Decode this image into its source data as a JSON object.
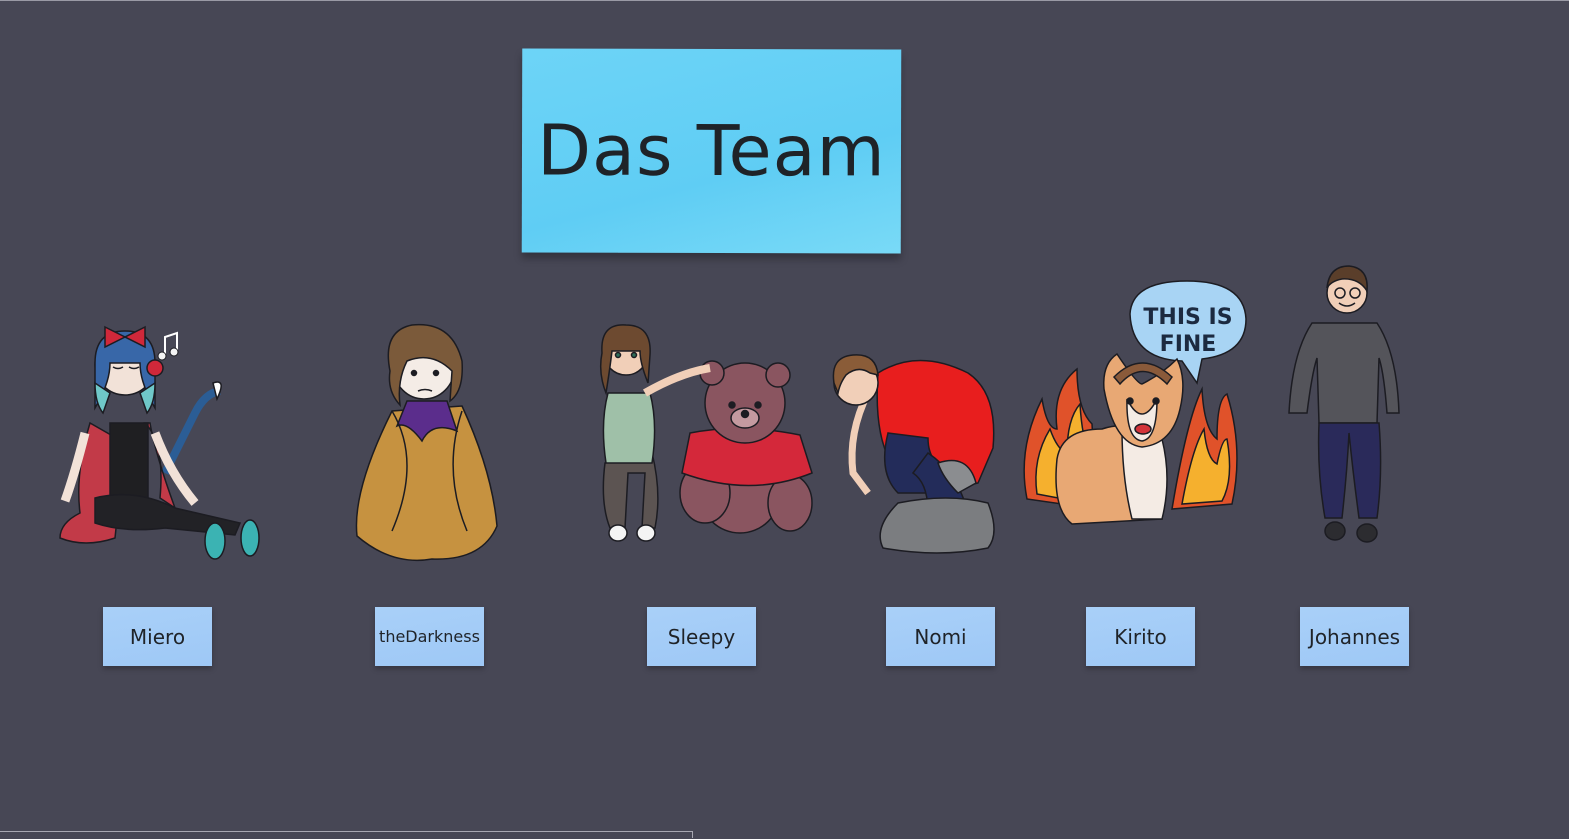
{
  "board": {
    "title": "Das Team",
    "bubble_text_line1": "THIS IS",
    "bubble_text_line2": "FINE"
  },
  "members": [
    {
      "name": "Miero"
    },
    {
      "name": "theDarkness"
    },
    {
      "name": "Sleepy"
    },
    {
      "name": "Nomi"
    },
    {
      "name": "Kirito"
    },
    {
      "name": "Johannes"
    }
  ],
  "colors": {
    "background": "#474755",
    "title_note": "#66d1f6",
    "name_note": "#a5cdf7"
  }
}
